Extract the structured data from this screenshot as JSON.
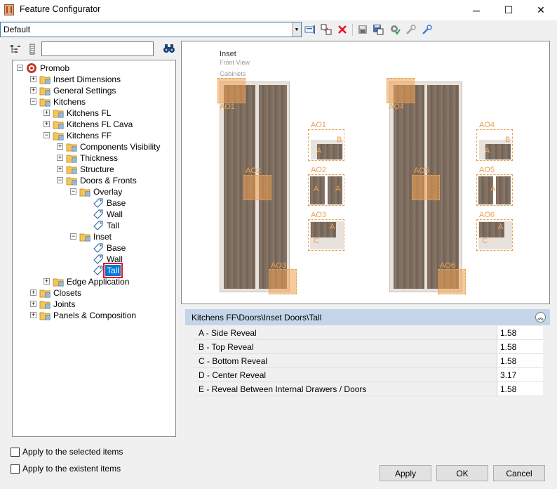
{
  "window": {
    "title": "Feature Configurator",
    "minimize_glyph": "─",
    "maximize_glyph": "☐",
    "close_glyph": "✕"
  },
  "toolbar": {
    "profile_value": "Default",
    "icons": [
      "new-profile-icon",
      "copy-profile-icon",
      "delete-icon",
      "save-icon",
      "save-as-icon",
      "settings-gear-icon",
      "tool-icon",
      "wrench-icon"
    ]
  },
  "tree": {
    "search_value": "",
    "items": [
      {
        "label": "Promob",
        "level": 0,
        "expanded": true,
        "icon": "promob-logo-icon"
      },
      {
        "label": "Insert Dimensions",
        "level": 1,
        "expanded": false,
        "icon": "folder-icon"
      },
      {
        "label": "General Settings",
        "level": 1,
        "expanded": false,
        "icon": "folder-icon"
      },
      {
        "label": "Kitchens",
        "level": 1,
        "expanded": true,
        "icon": "folder-icon"
      },
      {
        "label": "Kitchens FL",
        "level": 2,
        "expanded": false,
        "icon": "folder-icon"
      },
      {
        "label": "Kitchens FL Cava",
        "level": 2,
        "expanded": false,
        "icon": "folder-icon"
      },
      {
        "label": "Kitchens FF",
        "level": 2,
        "expanded": true,
        "icon": "folder-icon"
      },
      {
        "label": "Components Visibility",
        "level": 3,
        "expanded": false,
        "icon": "folder-icon"
      },
      {
        "label": "Thickness",
        "level": 3,
        "expanded": false,
        "icon": "folder-icon"
      },
      {
        "label": "Structure",
        "level": 3,
        "expanded": false,
        "icon": "folder-icon"
      },
      {
        "label": "Doors & Fronts",
        "level": 3,
        "expanded": true,
        "icon": "folder-icon"
      },
      {
        "label": "Overlay",
        "level": 4,
        "expanded": true,
        "icon": "folder-icon"
      },
      {
        "label": "Base",
        "level": 5,
        "icon": "tag-icon"
      },
      {
        "label": "Wall",
        "level": 5,
        "icon": "tag-icon"
      },
      {
        "label": "Tall",
        "level": 5,
        "icon": "tag-icon"
      },
      {
        "label": "Inset",
        "level": 4,
        "expanded": true,
        "icon": "folder-icon"
      },
      {
        "label": "Base",
        "level": 5,
        "icon": "tag-icon"
      },
      {
        "label": "Wall",
        "level": 5,
        "icon": "tag-icon"
      },
      {
        "label": "Tall",
        "level": 5,
        "icon": "tag-icon",
        "selected": true
      },
      {
        "label": "Edge Application",
        "level": 2,
        "expanded": false,
        "icon": "folder-icon"
      },
      {
        "label": "Closets",
        "level": 1,
        "expanded": false,
        "icon": "folder-icon"
      },
      {
        "label": "Joints",
        "level": 1,
        "expanded": false,
        "icon": "folder-icon"
      },
      {
        "label": "Panels & Composition",
        "level": 1,
        "expanded": false,
        "icon": "folder-icon"
      }
    ]
  },
  "options": {
    "apply_selected": "Apply to the selected items",
    "apply_existent": "Apply to the existent items"
  },
  "preview": {
    "title": "Inset",
    "subtitle": "Front View",
    "section": "Cabinets",
    "labels": {
      "ao1": "AO1",
      "ao2": "AO2",
      "ao3": "AO3",
      "ao4": "AO4",
      "ao5": "AO5",
      "ao6": "AO6",
      "a": "A",
      "b": "B",
      "c": "C"
    }
  },
  "properties": {
    "path": "Kitchens FF\\Doors\\Inset Doors\\Tall",
    "rows": [
      {
        "name": "A - Side Reveal",
        "value": "1.58"
      },
      {
        "name": "B - Top Reveal",
        "value": "1.58"
      },
      {
        "name": "C - Bottom Reveal",
        "value": "1.58"
      },
      {
        "name": "D - Center Reveal",
        "value": "3.17"
      },
      {
        "name": "E - Reveal Between Internal Drawers / Doors",
        "value": "1.58"
      }
    ]
  },
  "buttons": {
    "apply": "Apply",
    "ok": "OK",
    "cancel": "Cancel"
  },
  "colors": {
    "accent": "#0078d7",
    "highlight": "#e8a253",
    "header": "#c4d5ea",
    "selection_outline": "#e81123"
  }
}
